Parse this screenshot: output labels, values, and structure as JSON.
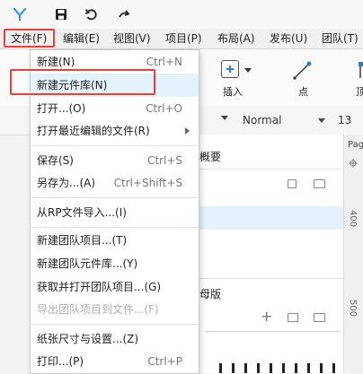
{
  "menubar": {
    "items": [
      "文件(F)",
      "编辑(E)",
      "视图(V)",
      "项目(P)",
      "布局(A)",
      "发布(U)",
      "团队(T)"
    ]
  },
  "toolbar": {
    "insert_label": "插入",
    "point_label": "点",
    "top_partial_label": "顶"
  },
  "formatbar": {
    "style_value": "Normal",
    "size_value": "13",
    "page_partial": "Pag"
  },
  "summary_panel": {
    "title_partial": "概要"
  },
  "masters_panel": {
    "title_partial": "母版"
  },
  "ruler": {
    "mark_400": "400",
    "mark_500": "500"
  },
  "file_menu": {
    "items": [
      {
        "label": "新建(N)",
        "shortcut": "Ctrl+N"
      },
      {
        "label": "新建元件库(N)",
        "shortcut": ""
      },
      {
        "label": "打开...(O)",
        "shortcut": "Ctrl+O"
      },
      {
        "label": "打开最近编辑的文件(R)",
        "shortcut": ""
      },
      {
        "label": "保存(S)",
        "shortcut": "Ctrl+S"
      },
      {
        "label": "另存为...(A)",
        "shortcut": "Ctrl+Shift+S"
      },
      {
        "label": "从RP文件导入...(I)",
        "shortcut": ""
      },
      {
        "label": "新建团队项目...(T)",
        "shortcut": ""
      },
      {
        "label": "新建团队元件库...(Y)",
        "shortcut": ""
      },
      {
        "label": "获取并打开团队项目...(G)",
        "shortcut": ""
      },
      {
        "label": "导出团队项目到文件...(F)",
        "shortcut": ""
      },
      {
        "label": "纸张尺寸与设置...(Z)",
        "shortcut": ""
      },
      {
        "label": "打印...(P)",
        "shortcut": "Ctrl+P"
      }
    ]
  }
}
